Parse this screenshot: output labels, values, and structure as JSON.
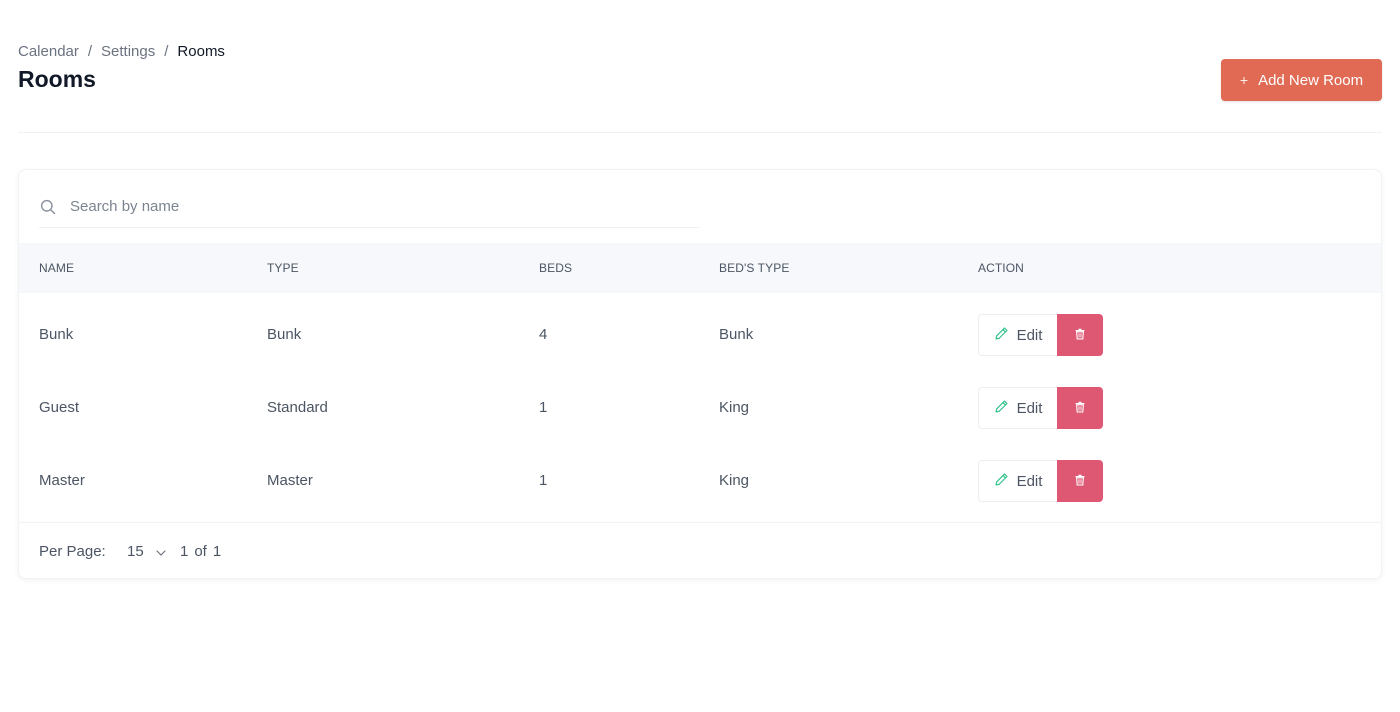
{
  "breadcrumb": {
    "items": [
      "Calendar",
      "Settings",
      "Rooms"
    ],
    "separator": "/"
  },
  "page": {
    "title": "Rooms",
    "add_button_label": "Add New Room",
    "add_button_icon": "plus-icon"
  },
  "search": {
    "placeholder": "Search by name",
    "value": ""
  },
  "table": {
    "columns": [
      "NAME",
      "TYPE",
      "BEDS",
      "BED'S TYPE",
      "ACTION"
    ],
    "rows": [
      {
        "name": "Bunk",
        "type": "Bunk",
        "beds": "4",
        "bed_type": "Bunk"
      },
      {
        "name": "Guest",
        "type": "Standard",
        "beds": "1",
        "bed_type": "King"
      },
      {
        "name": "Master",
        "type": "Master",
        "beds": "1",
        "bed_type": "King"
      }
    ],
    "edit_label": "Edit"
  },
  "pagination": {
    "per_page_label": "Per Page:",
    "per_page_value": "15",
    "current_page": "1",
    "of_label": "of",
    "total_pages": "1"
  },
  "colors": {
    "primary": "#e06a54",
    "danger": "#de5873",
    "edit_icon": "#34c48b",
    "header_bg": "#f7f8fb"
  }
}
